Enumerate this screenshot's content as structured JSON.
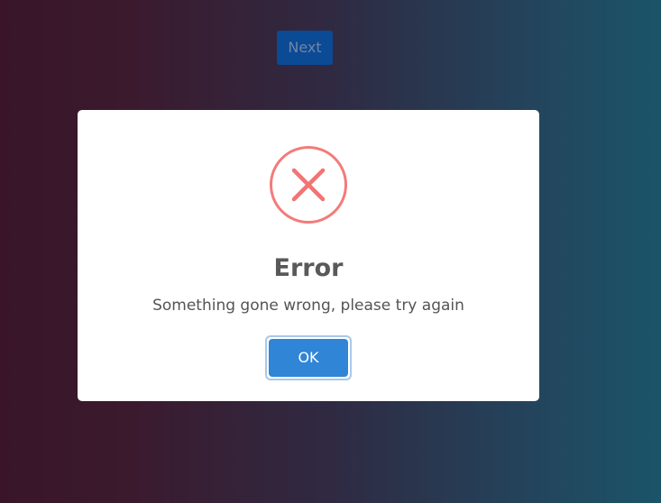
{
  "background": {
    "gradient_start": "#3a1529",
    "gradient_end": "#1b5468"
  },
  "toolbar": {
    "next_label": "Next"
  },
  "modal": {
    "icon": "error-x-circle-icon",
    "icon_color": "#f27474",
    "title": "Error",
    "message": "Something gone wrong, please try again",
    "ok_label": "OK",
    "ok_color": "#3085d6"
  }
}
